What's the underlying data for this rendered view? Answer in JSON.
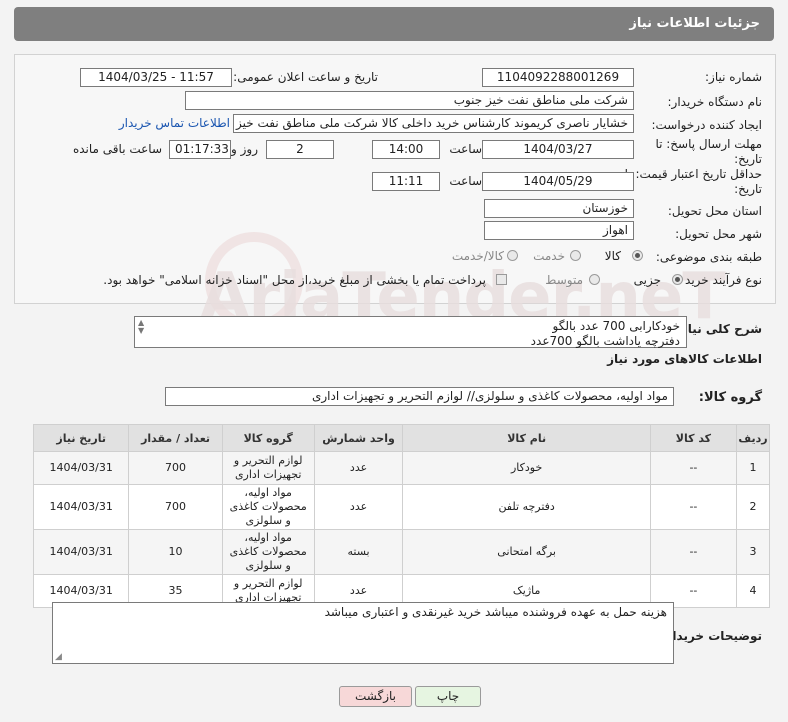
{
  "header": {
    "title": "جزئیات اطلاعات نیاز"
  },
  "form": {
    "need_number_label": "شماره نیاز:",
    "need_number": "1104092288001269",
    "announce_label": "تاریخ و ساعت اعلان عمومی:",
    "announce_value": "1404/03/25 - 11:57",
    "buyer_label": "نام دستگاه خریدار:",
    "buyer_value": "شرکت ملی مناطق نفت خیز جنوب",
    "creator_label": "ایجاد کننده درخواست:",
    "creator_value": "خشایار ناصری کریموند کارشناس خرید داخلی کالا  شرکت ملی مناطق نفت خیز",
    "contact_link": "اطلاعات تماس خریدار",
    "deadline_label": "مهلت ارسال پاسخ: تا تاریخ:",
    "deadline_date": "1404/03/27",
    "time_label": "ساعت",
    "deadline_time": "14:00",
    "days_value": "2",
    "days_label": "روز و",
    "remaining_value": "01:17:33",
    "remaining_label": "ساعت باقی مانده",
    "price_label": "حداقل تاریخ اعتبار قیمت: تا تاریخ:",
    "price_date": "1404/05/29",
    "price_time": "11:11",
    "province_label": "استان محل تحویل:",
    "province_value": "خوزستان",
    "city_label": "شهر محل تحویل:",
    "city_value": "اهواز",
    "category_label": "طبقه بندی موضوعی:",
    "category_options": [
      "کالا",
      "خدمت",
      "کالا/خدمت"
    ],
    "process_label": "نوع فرآیند خرید :",
    "process_options": [
      "جزیی",
      "متوسط"
    ],
    "payment_note": "پرداخت تمام یا بخشی از مبلغ خرید،از محل \"اسناد خزانه اسلامی\" خواهد بود."
  },
  "watermark": "AriaTender.neT",
  "summary": {
    "label": "شرح کلی نیاز:",
    "lines": [
      "خودکارابی 700 عدد بالگو",
      "دفترچه یاداشت بالگو 700عدد"
    ]
  },
  "goods": {
    "section_title": "اطلاعات کالاهای مورد نیاز",
    "group_label": "گروه کالا:",
    "group_value": "مواد اولیه، محصولات کاغذی و سلولزی// لوازم التحریر و تجهیزات اداری"
  },
  "table": {
    "headers": [
      "ردیف",
      "کد کالا",
      "نام کالا",
      "واحد شمارش",
      "گروه کالا",
      "تعداد / مقدار",
      "تاریخ نیاز"
    ],
    "rows": [
      {
        "index": "1",
        "code": "--",
        "name": "خودکار",
        "unit": "عدد",
        "group": "لوازم التحریر و تجهیزات اداری",
        "qty": "700",
        "date": "1404/03/31"
      },
      {
        "index": "2",
        "code": "--",
        "name": "دفترچه تلفن",
        "unit": "عدد",
        "group": "مواد اولیه، محصولات کاغذی و سلولزی",
        "qty": "700",
        "date": "1404/03/31"
      },
      {
        "index": "3",
        "code": "--",
        "name": "برگه امتحانی",
        "unit": "بسته",
        "group": "مواد اولیه، محصولات کاغذی و سلولزی",
        "qty": "10",
        "date": "1404/03/31"
      },
      {
        "index": "4",
        "code": "--",
        "name": "ماژیک",
        "unit": "عدد",
        "group": "لوازم التحریر و تجهیزات اداری",
        "qty": "35",
        "date": "1404/03/31"
      }
    ]
  },
  "buyer_notes": {
    "label": "توضیحات خریدار:",
    "text": "هزینه حمل به عهده فروشنده میباشد خرید غیرنقدی و اعتباری میباشد"
  },
  "buttons": {
    "back": "بازگشت",
    "print": "چاپ"
  },
  "colors": {
    "header": "#7f7f7f",
    "link": "#1a55b0",
    "back_button": "#f7d8d8",
    "print_button": "#e6f5e1"
  }
}
